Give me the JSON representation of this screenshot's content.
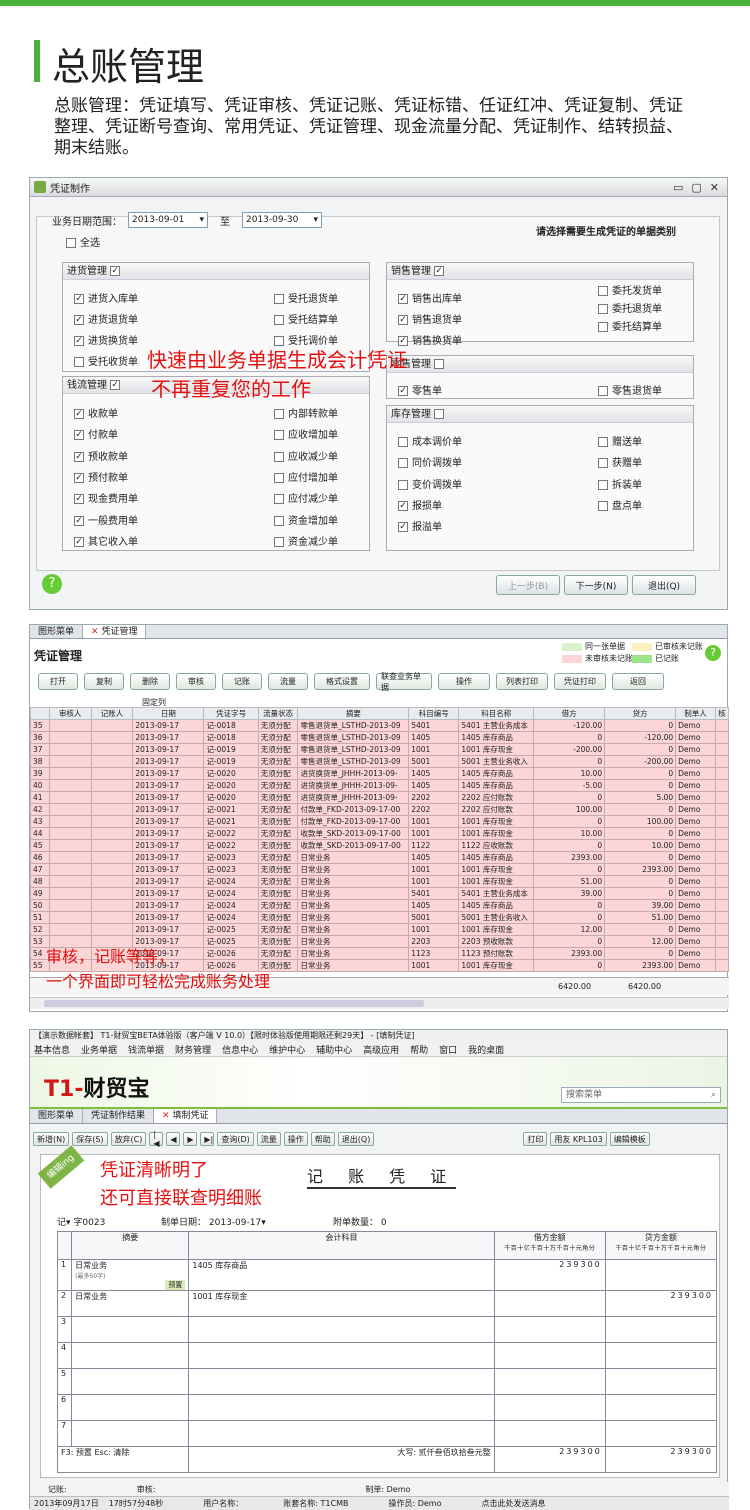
{
  "hero": {
    "title": "总账管理",
    "intro": "总账管理：凭证填写、凭证审核、凭证记账、凭证标错、任证红冲、凭证复制、凭证整理、凭证断号查询、常用凭证、凭证管理、现金流量分配、凭证制作、结转损益、期末结账。"
  },
  "w1": {
    "title": "凭证制作",
    "date_label": "业务日期范围：",
    "date_from": "2013-09-01",
    "to": "至",
    "date_to": "2013-09-30",
    "select_all": "全选",
    "hint": "请选择需要生成凭证的单据类别",
    "purchase": {
      "title": "进货管理",
      "left": [
        "进货入库单",
        "进货退货单",
        "进货换货单",
        "受托收货单"
      ],
      "right": [
        "受托退货单",
        "受托结算单",
        "受托调价单"
      ]
    },
    "cash": {
      "title": "钱流管理",
      "left": [
        "收款单",
        "付款单",
        "预收款单",
        "预付款单",
        "现金费用单",
        "一般费用单",
        "其它收入单"
      ],
      "right": [
        "内部转款单",
        "应收增加单",
        "应收减少单",
        "应付增加单",
        "应付减少单",
        "资金增加单",
        "资金减少单"
      ]
    },
    "sales": {
      "title": "销售管理",
      "left": [
        "销售出库单",
        "销售退货单",
        "销售换货单"
      ],
      "right": [
        "委托发货单",
        "委托退货单",
        "委托结算单"
      ]
    },
    "retail": {
      "title": "零售管理",
      "left": [
        "零售单"
      ],
      "right": [
        "零售退货单"
      ]
    },
    "stock": {
      "title": "库存管理",
      "left": [
        "成本调价单",
        "同价调拨单",
        "变价调拨单",
        "报损单",
        "报溢单"
      ],
      "right": [
        "赠送单",
        "获赠单",
        "拆装单",
        "盘点单"
      ]
    },
    "buttons": {
      "prev": "上一步(B)",
      "next": "下一步(N)",
      "exit": "退出(Q)"
    },
    "overlay1": "快速由业务单据生成会计凭证",
    "overlay2": "不再重复您的工作"
  },
  "w2": {
    "tabs": [
      "图形菜单",
      "凭证管理"
    ],
    "title": "凭证管理",
    "legend": [
      "同一张单据",
      "已审核未记账",
      "未审核未记账",
      "已记账"
    ],
    "toolbar": [
      "打开",
      "复制",
      "删除",
      "审核",
      "记账",
      "流量",
      "格式设置",
      "联查业务单据",
      "操作",
      "列表打印",
      "凭证打印",
      "返回"
    ],
    "fixed_col": "固定列",
    "headers": [
      "",
      "审核人",
      "记账人",
      "日期",
      "凭证字号",
      "流量状态",
      "摘要",
      "科目编号",
      "科目名称",
      "借方",
      "贷方",
      "制单人",
      "核"
    ],
    "rows": [
      [
        "35",
        "",
        "",
        "2013-09-17",
        "记-0018",
        "无须分配",
        "零售退货单_LSTHD-2013-09",
        "5401",
        "5401 主营业务成本",
        "-120.00",
        "0",
        "Demo"
      ],
      [
        "36",
        "",
        "",
        "2013-09-17",
        "记-0018",
        "无须分配",
        "零售退货单_LSTHD-2013-09",
        "1405",
        "1405 库存商品",
        "0",
        "-120.00",
        "Demo"
      ],
      [
        "37",
        "",
        "",
        "2013-09-17",
        "记-0019",
        "无须分配",
        "零售退货单_LSTHD-2013-09",
        "1001",
        "1001 库存现金",
        "-200.00",
        "0",
        "Demo"
      ],
      [
        "38",
        "",
        "",
        "2013-09-17",
        "记-0019",
        "无须分配",
        "零售退货单_LSTHD-2013-09",
        "5001",
        "5001 主营业务收入",
        "0",
        "-200.00",
        "Demo"
      ],
      [
        "39",
        "",
        "",
        "2013-09-17",
        "记-0020",
        "无须分配",
        "进货换货单_JHHH-2013-09-",
        "1405",
        "1405 库存商品",
        "10.00",
        "0",
        "Demo"
      ],
      [
        "40",
        "",
        "",
        "2013-09-17",
        "记-0020",
        "无须分配",
        "进货换货单_JHHH-2013-09-",
        "1405",
        "1405 库存商品",
        "-5.00",
        "0",
        "Demo"
      ],
      [
        "41",
        "",
        "",
        "2013-09-17",
        "记-0020",
        "无须分配",
        "进货换货单_JHHH-2013-09-",
        "2202",
        "2202 应付账款",
        "0",
        "5.00",
        "Demo"
      ],
      [
        "42",
        "",
        "",
        "2013-09-17",
        "记-0021",
        "无须分配",
        "付款单_FKD-2013-09-17-00",
        "2202",
        "2202 应付账款",
        "100.00",
        "0",
        "Demo"
      ],
      [
        "43",
        "",
        "",
        "2013-09-17",
        "记-0021",
        "无须分配",
        "付款单_FKD-2013-09-17-00",
        "1001",
        "1001 库存现金",
        "0",
        "100.00",
        "Demo"
      ],
      [
        "44",
        "",
        "",
        "2013-09-17",
        "记-0022",
        "无须分配",
        "收款单_SKD-2013-09-17-00",
        "1001",
        "1001 库存现金",
        "10.00",
        "0",
        "Demo"
      ],
      [
        "45",
        "",
        "",
        "2013-09-17",
        "记-0022",
        "无须分配",
        "收款单_SKD-2013-09-17-00",
        "1122",
        "1122 应收账款",
        "0",
        "10.00",
        "Demo"
      ],
      [
        "46",
        "",
        "",
        "2013-09-17",
        "记-0023",
        "无须分配",
        "日常业务",
        "1405",
        "1405 库存商品",
        "2393.00",
        "0",
        "Demo"
      ],
      [
        "47",
        "",
        "",
        "2013-09-17",
        "记-0023",
        "无须分配",
        "日常业务",
        "1001",
        "1001 库存现金",
        "0",
        "2393.00",
        "Demo"
      ],
      [
        "48",
        "",
        "",
        "2013-09-17",
        "记-0024",
        "无须分配",
        "日常业务",
        "1001",
        "1001 库存现金",
        "51.00",
        "0",
        "Demo"
      ],
      [
        "49",
        "",
        "",
        "2013-09-17",
        "记-0024",
        "无须分配",
        "日常业务",
        "5401",
        "5401 主营业务成本",
        "39.00",
        "0",
        "Demo"
      ],
      [
        "50",
        "",
        "",
        "2013-09-17",
        "记-0024",
        "无须分配",
        "日常业务",
        "1405",
        "1405 库存商品",
        "0",
        "39.00",
        "Demo"
      ],
      [
        "51",
        "",
        "",
        "2013-09-17",
        "记-0024",
        "无须分配",
        "日常业务",
        "5001",
        "5001 主营业务收入",
        "0",
        "51.00",
        "Demo"
      ],
      [
        "52",
        "",
        "",
        "2013-09-17",
        "记-0025",
        "无须分配",
        "日常业务",
        "1001",
        "1001 库存现金",
        "12.00",
        "0",
        "Demo"
      ],
      [
        "53",
        "",
        "",
        "2013-09-17",
        "记-0025",
        "无须分配",
        "日常业务",
        "2203",
        "2203 预收账款",
        "0",
        "12.00",
        "Demo"
      ],
      [
        "54",
        "",
        "",
        "2013-09-17",
        "记-0026",
        "无须分配",
        "日常业务",
        "1123",
        "1123 预付账款",
        "2393.00",
        "0",
        "Demo"
      ],
      [
        "55",
        "",
        "",
        "2013-09-17",
        "记-0026",
        "无须分配",
        "日常业务",
        "1001",
        "1001 库存现金",
        "0",
        "2393.00",
        "Demo"
      ]
    ],
    "sum_debit": "6420.00",
    "sum_credit": "6420.00",
    "overlay1": "审核，记账等等，",
    "overlay2": "一个界面即可轻松完成账务处理"
  },
  "w3": {
    "app_title": "【演示数据帐套】 T1-财贸宝BETA体验版（客户端 V 10.0）【限时体验版使用期限还剩29天】 - [填制凭证]",
    "menu": [
      "基本信息",
      "业务单据",
      "钱流单据",
      "财务管理",
      "信息中心",
      "维护中心",
      "辅助中心",
      "高级应用",
      "帮助",
      "窗口",
      "我的桌面"
    ],
    "logo_a": "T1-",
    "logo_b": "财贸宝",
    "search": "搜索菜单",
    "tabs": [
      "图形菜单",
      "凭证制作结果",
      "填制凭证"
    ],
    "toolbar": [
      "新增(N)",
      "保存(S)",
      "放弃(C)",
      "查询(D)",
      "流量",
      "操作",
      "帮助",
      "退出(Q)",
      "打印",
      "用友 KPL103",
      "编辑模板"
    ],
    "edit_tag": "编辑ing",
    "voucher_title": "记 账 凭 证",
    "word": "记",
    "no": "字0023",
    "make_date_label": "制单日期：",
    "make_date": "2013-09-17",
    "attach_label": "附单数量：",
    "attach": "0",
    "headers": {
      "summary": "摘要",
      "account": "会计科目",
      "debit": "借方金额",
      "credit": "贷方金额",
      "digits": "千百十亿千百十万千百十元角分"
    },
    "entries": [
      {
        "n": "1",
        "summary": "日常业务",
        "sub": "(最多50字)",
        "tag": "预置",
        "account": "1405  库存商品",
        "debit": "239300",
        "credit": ""
      },
      {
        "n": "2",
        "summary": "日常业务",
        "sub": "",
        "tag": "",
        "account": "1001  库存现金",
        "debit": "",
        "credit": "239300"
      },
      {
        "n": "3"
      },
      {
        "n": "4"
      },
      {
        "n": "5"
      },
      {
        "n": "6"
      },
      {
        "n": "7"
      }
    ],
    "keys": "F3: 预置     Esc: 清除",
    "capital": "大写: 贰仟叁佰玖拾叁元整",
    "total_debit": "239300",
    "total_credit": "239300",
    "footer": {
      "book": "记账:",
      "audit": "审核:",
      "maker": "制单: Demo"
    },
    "status": {
      "date": "2013年09月17日",
      "time": "17时57分48秒",
      "user": "用户名称：",
      "account": "账套名称: T1CMB",
      "operator": "操作员: Demo",
      "msg": "点击此处发送消息"
    },
    "overlay1": "凭证清晰明了",
    "overlay2": "还可直接联查明细账"
  },
  "colors": {
    "accent": "#4bb33c",
    "pink_row": "#fcd6d6",
    "overlay": "#e41010"
  }
}
